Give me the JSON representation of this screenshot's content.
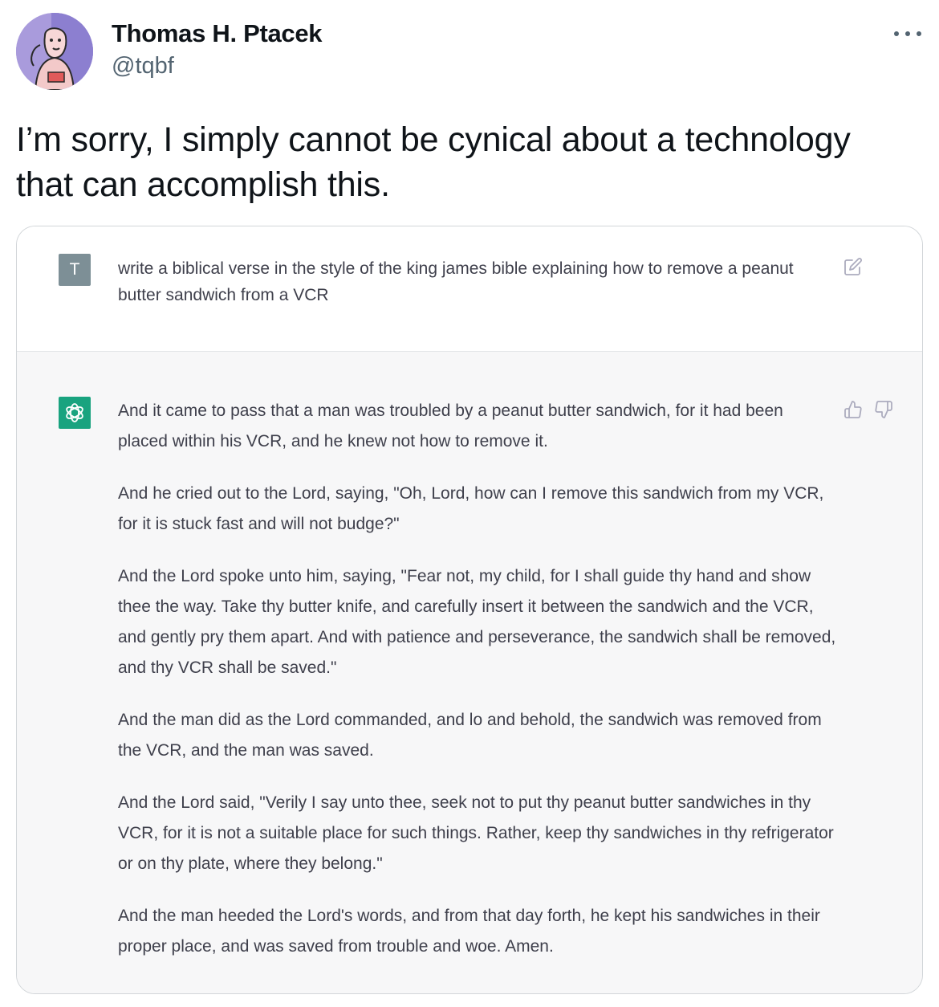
{
  "tweet": {
    "author_name": "Thomas H. Ptacek",
    "author_handle": "@tqbf",
    "text": "I’m sorry, I simply cannot be cynical about a technology that can accomplish this.",
    "more_icon": "more-horizontal-icon"
  },
  "chat": {
    "user_avatar_letter": "T",
    "prompt": "write a biblical verse in the style of the king james bible explaining how to remove a peanut butter sandwich from a VCR",
    "response_paragraphs": [
      "And it came to pass that a man was troubled by a peanut butter sandwich, for it had been placed within his VCR, and he knew not how to remove it.",
      "And he cried out to the Lord, saying, \"Oh, Lord, how can I remove this sandwich from my VCR, for it is stuck fast and will not budge?\"",
      "And the Lord spoke unto him, saying, \"Fear not, my child, for I shall guide thy hand and show thee the way. Take thy butter knife, and carefully insert it between the sandwich and the VCR, and gently pry them apart. And with patience and perseverance, the sandwich shall be removed, and thy VCR shall be saved.\"",
      "And the man did as the Lord commanded, and lo and behold, the sandwich was removed from the VCR, and the man was saved.",
      "And the Lord said, \"Verily I say unto thee, seek not to put thy peanut butter sandwiches in thy VCR, for it is not a suitable place for such things. Rather, keep thy sandwiches in thy refrigerator or on thy plate, where they belong.\"",
      "And the man heeded the Lord's words, and from that day forth, he kept his sandwiches in their proper place, and was saved from trouble and woe. Amen."
    ],
    "icons": [
      "edit-icon",
      "openai-logo-icon",
      "thumbs-up-icon",
      "thumbs-down-icon"
    ]
  },
  "colors": {
    "text_primary": "#0f1419",
    "text_secondary": "#536471",
    "chat_text": "#3e3f4b",
    "response_bg": "#f7f7f8",
    "gpt_green": "#19a37f",
    "user_avatar_bg": "#7d8f96"
  }
}
